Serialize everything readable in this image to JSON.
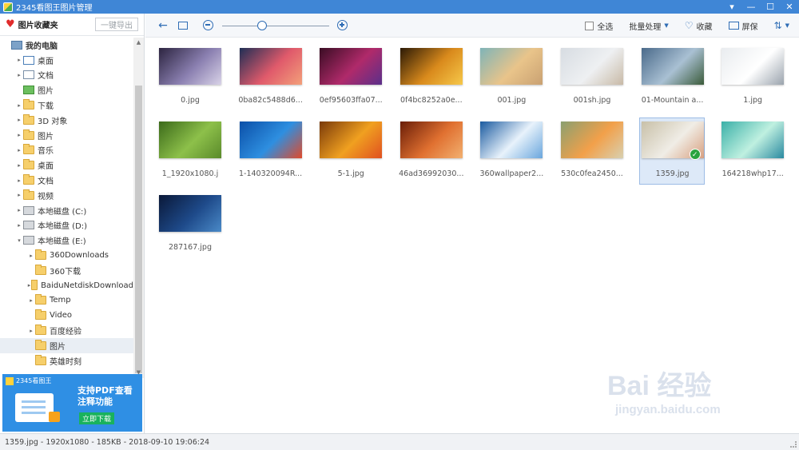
{
  "window": {
    "title": "2345看图王图片管理"
  },
  "sidebar": {
    "favorites_label": "图片收藏夹",
    "export_button": "一键导出",
    "tree": [
      {
        "label": "我的电脑",
        "level": 0,
        "arrow": "",
        "icon": "pc",
        "bold": true
      },
      {
        "label": "桌面",
        "level": 1,
        "arrow": "▸",
        "icon": "desktop"
      },
      {
        "label": "文档",
        "level": 1,
        "arrow": "▸",
        "icon": "doc"
      },
      {
        "label": "图片",
        "level": 1,
        "arrow": "",
        "icon": "pic"
      },
      {
        "label": "下载",
        "level": 1,
        "arrow": "▸",
        "icon": "folder"
      },
      {
        "label": "3D 对象",
        "level": 1,
        "arrow": "▸",
        "icon": "folder"
      },
      {
        "label": "图片",
        "level": 1,
        "arrow": "▸",
        "icon": "folder"
      },
      {
        "label": "音乐",
        "level": 1,
        "arrow": "▸",
        "icon": "folder"
      },
      {
        "label": "桌面",
        "level": 1,
        "arrow": "▸",
        "icon": "folder"
      },
      {
        "label": "文档",
        "level": 1,
        "arrow": "▸",
        "icon": "folder"
      },
      {
        "label": "视频",
        "level": 1,
        "arrow": "▸",
        "icon": "folder"
      },
      {
        "label": "本地磁盘 (C:)",
        "level": 1,
        "arrow": "▸",
        "icon": "disk"
      },
      {
        "label": "本地磁盘 (D:)",
        "level": 1,
        "arrow": "▸",
        "icon": "disk"
      },
      {
        "label": "本地磁盘 (E:)",
        "level": 1,
        "arrow": "▾",
        "icon": "disk"
      },
      {
        "label": "360Downloads",
        "level": 2,
        "arrow": "▸",
        "icon": "folder"
      },
      {
        "label": "360下载",
        "level": 2,
        "arrow": "",
        "icon": "folder"
      },
      {
        "label": "BaiduNetdiskDownload",
        "level": 2,
        "arrow": "▸",
        "icon": "folder"
      },
      {
        "label": "Temp",
        "level": 2,
        "arrow": "▸",
        "icon": "folder"
      },
      {
        "label": "Video",
        "level": 2,
        "arrow": "",
        "icon": "folder"
      },
      {
        "label": "百度经验",
        "level": 2,
        "arrow": "▸",
        "icon": "folder"
      },
      {
        "label": "图片",
        "level": 2,
        "arrow": "",
        "icon": "folder",
        "selected": true
      },
      {
        "label": "英雄时刻",
        "level": 2,
        "arrow": "",
        "icon": "folder"
      }
    ],
    "ad": {
      "brand": "2345看图王",
      "line1": "支持PDF查看",
      "line2": "注释功能",
      "button": "立即下载"
    }
  },
  "toolbar": {
    "select_all": "全选",
    "batch": "批量处理",
    "favorite": "收藏",
    "fullscreen": "屏保",
    "zoom_level": 0.37
  },
  "files": [
    {
      "name": "0.jpg",
      "colors": [
        "#2c2440",
        "#8a7fb0",
        "#d9d3e8"
      ]
    },
    {
      "name": "0ba82c5488d6...",
      "colors": [
        "#1e2e55",
        "#e05a6b",
        "#f3a07a"
      ]
    },
    {
      "name": "0ef95603ffa07...",
      "colors": [
        "#3a0d24",
        "#b02a6a",
        "#5a2f8a"
      ]
    },
    {
      "name": "0f4bc8252a0e...",
      "colors": [
        "#2b1a06",
        "#d98a1c",
        "#f6c84a"
      ]
    },
    {
      "name": "001.jpg",
      "colors": [
        "#7fb4b8",
        "#e9c48a",
        "#c9a172"
      ]
    },
    {
      "name": "001sh.jpg",
      "colors": [
        "#d7dce2",
        "#eef0f2",
        "#c8b9a6"
      ]
    },
    {
      "name": "01-Mountain a...",
      "colors": [
        "#4a6a8a",
        "#a9c0d3",
        "#3b5b3a"
      ]
    },
    {
      "name": "1.jpg",
      "colors": [
        "#e9ecef",
        "#ffffff",
        "#9aa3ad"
      ]
    },
    {
      "name": "1_1920x1080.j",
      "colors": [
        "#3b6a1a",
        "#8dc04a",
        "#5a8a2a"
      ]
    },
    {
      "name": "1-140320094R...",
      "colors": [
        "#0b4fa8",
        "#2e8fe0",
        "#e04a2a"
      ]
    },
    {
      "name": "5-1.jpg",
      "colors": [
        "#7a3a0a",
        "#f0a020",
        "#e05020"
      ]
    },
    {
      "name": "46ad36992030...",
      "colors": [
        "#6a1e08",
        "#e07030",
        "#f2b070"
      ]
    },
    {
      "name": "360wallpaper2...",
      "colors": [
        "#1a5aa0",
        "#e8f2fb",
        "#6aa6dd"
      ]
    },
    {
      "name": "530c0fea2450...",
      "colors": [
        "#8aa070",
        "#f2a04a",
        "#d8d0b0"
      ]
    },
    {
      "name": "1359.jpg",
      "colors": [
        "#c8c0a8",
        "#f0ede6",
        "#d8a080"
      ],
      "selected": true
    },
    {
      "name": "164218whp17...",
      "colors": [
        "#3ab0a8",
        "#bff0e0",
        "#2a8aa0"
      ]
    },
    {
      "name": "287167.jpg",
      "colors": [
        "#0a1838",
        "#1e4a8a",
        "#4a8ac8"
      ]
    }
  ],
  "status": {
    "text": "1359.jpg - 1920x1080 - 185KB - 2018-09-10 19:06:24"
  },
  "watermark": {
    "line1": "Bai 经验",
    "line2": "jingyan.baidu.com"
  }
}
